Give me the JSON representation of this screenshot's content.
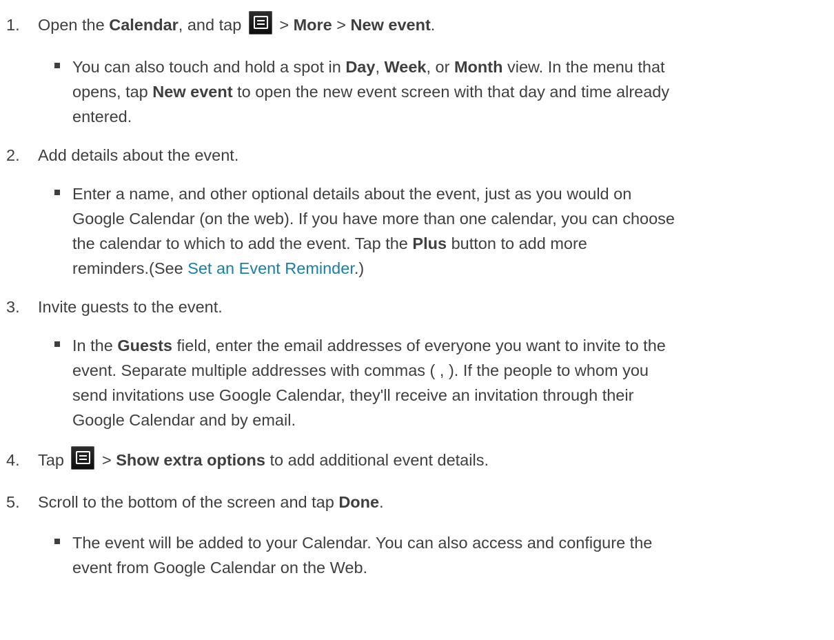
{
  "steps": [
    {
      "num": "1.",
      "parts": [
        "Open the ",
        "Calendar",
        ", and tap ",
        " > ",
        "More",
        " > ",
        "New event",
        "."
      ],
      "bullet": {
        "lines": [
          [
            "You can also touch and hold a spot in ",
            "Day",
            ", ",
            "Week",
            ", or ",
            "Month",
            " view. In the menu that"
          ],
          [
            "opens, tap ",
            "New event",
            " to open the new event screen with that day and time already"
          ],
          [
            "entered."
          ]
        ]
      }
    },
    {
      "num": "2.",
      "parts": [
        "Add details about the event."
      ],
      "bullet": {
        "lines": [
          [
            "Enter a name, and other optional details about the event, just as you would on"
          ],
          [
            "Google Calendar (on the web). If you have more than one calendar, you can choose"
          ],
          [
            "the calendar to which to add the event. Tap the ",
            "Plus",
            " button to add more"
          ],
          [
            "reminders.(See ",
            "Set an Event Reminder",
            ".)"
          ]
        ]
      }
    },
    {
      "num": "3.",
      "parts": [
        "Invite guests to the event."
      ],
      "bullet": {
        "lines": [
          [
            "In the ",
            "Guests",
            " field, enter the email addresses of everyone you want to invite to the"
          ],
          [
            "event. Separate multiple addresses with commas ( , ). If the people to whom you"
          ],
          [
            "send invitations use Google Calendar, they'll receive an invitation through their"
          ],
          [
            "Google Calendar and by email."
          ]
        ]
      }
    },
    {
      "num": "4.",
      "parts": [
        "Tap ",
        " > ",
        "Show extra options",
        " to add additional event details."
      ]
    },
    {
      "num": "5.",
      "parts": [
        "Scroll to the bottom of the screen and tap ",
        "Done",
        "."
      ],
      "bullet": {
        "lines": [
          [
            "The event will be added to your Calendar. You can also access and configure the"
          ],
          [
            "event from Google Calendar on the Web."
          ]
        ]
      }
    }
  ],
  "icons": {
    "menu": "menu-key-icon"
  },
  "colors": {
    "text": "#3f3f3f",
    "link": "#1a7fa6",
    "icon_bg": "#1a1a1a"
  }
}
